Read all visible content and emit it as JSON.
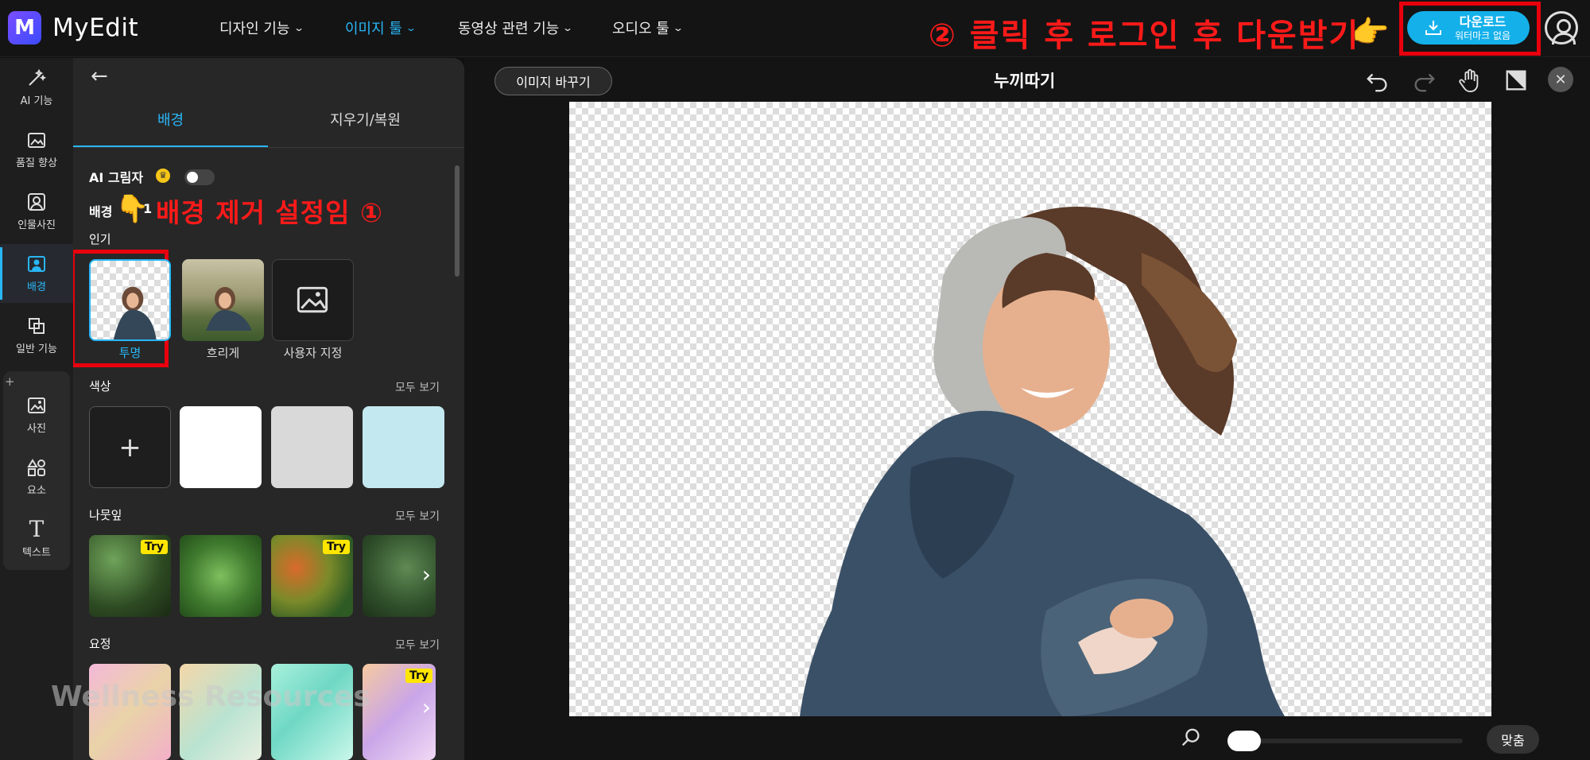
{
  "app": {
    "name": "MyEdit",
    "logo_letter": "M"
  },
  "nav": [
    {
      "label": "디자인 기능",
      "active": false
    },
    {
      "label": "이미지 툴",
      "active": true
    },
    {
      "label": "동영상 관련 기능",
      "active": false
    },
    {
      "label": "오디오 툴",
      "active": false
    }
  ],
  "annotations": {
    "step2": "② 클릭 후 로그인 후 다운받기",
    "step1": "배경 제거 설정임 ①"
  },
  "download": {
    "label": "다운로드",
    "sublabel": "워터마크 없음"
  },
  "rail": [
    {
      "label": "AI 기능",
      "icon": "magic-wand-icon"
    },
    {
      "label": "품질 향상",
      "icon": "image-enhance-icon"
    },
    {
      "label": "인물사진",
      "icon": "portrait-icon"
    },
    {
      "label": "배경",
      "icon": "background-icon",
      "active": true
    },
    {
      "label": "일반 기능",
      "icon": "crop-icon"
    },
    {
      "label": "사진",
      "icon": "photo-icon"
    },
    {
      "label": "요소",
      "icon": "elements-icon"
    },
    {
      "label": "텍스트",
      "icon": "text-icon"
    }
  ],
  "panel": {
    "tabs": [
      "배경",
      "지우기/복원"
    ],
    "ai_shadow_label": "AI 그림자",
    "bg_label": "배경",
    "bg_label_suffix": "1",
    "popular_label": "인기",
    "bg_options": [
      "투명",
      "흐리게",
      "사용자 지정"
    ],
    "color_label": "색상",
    "see_all": "모두 보기",
    "color_add": "+",
    "colors": [
      "#ffffff",
      "#d9d9d9",
      "#c4e8ef"
    ],
    "leaf_label": "나뭇잎",
    "fairy_label": "요정",
    "try_badge": "Try"
  },
  "watermark": "Wellness Resources",
  "canvas": {
    "replace_label": "이미지 바꾸기",
    "title": "누끼따기",
    "fit_label": "맞춤",
    "zoom_level": 0.0
  },
  "colors": {
    "accent": "#29b6f6",
    "annotation": "#ff1a1a",
    "download_bg": "#14b0ea"
  }
}
